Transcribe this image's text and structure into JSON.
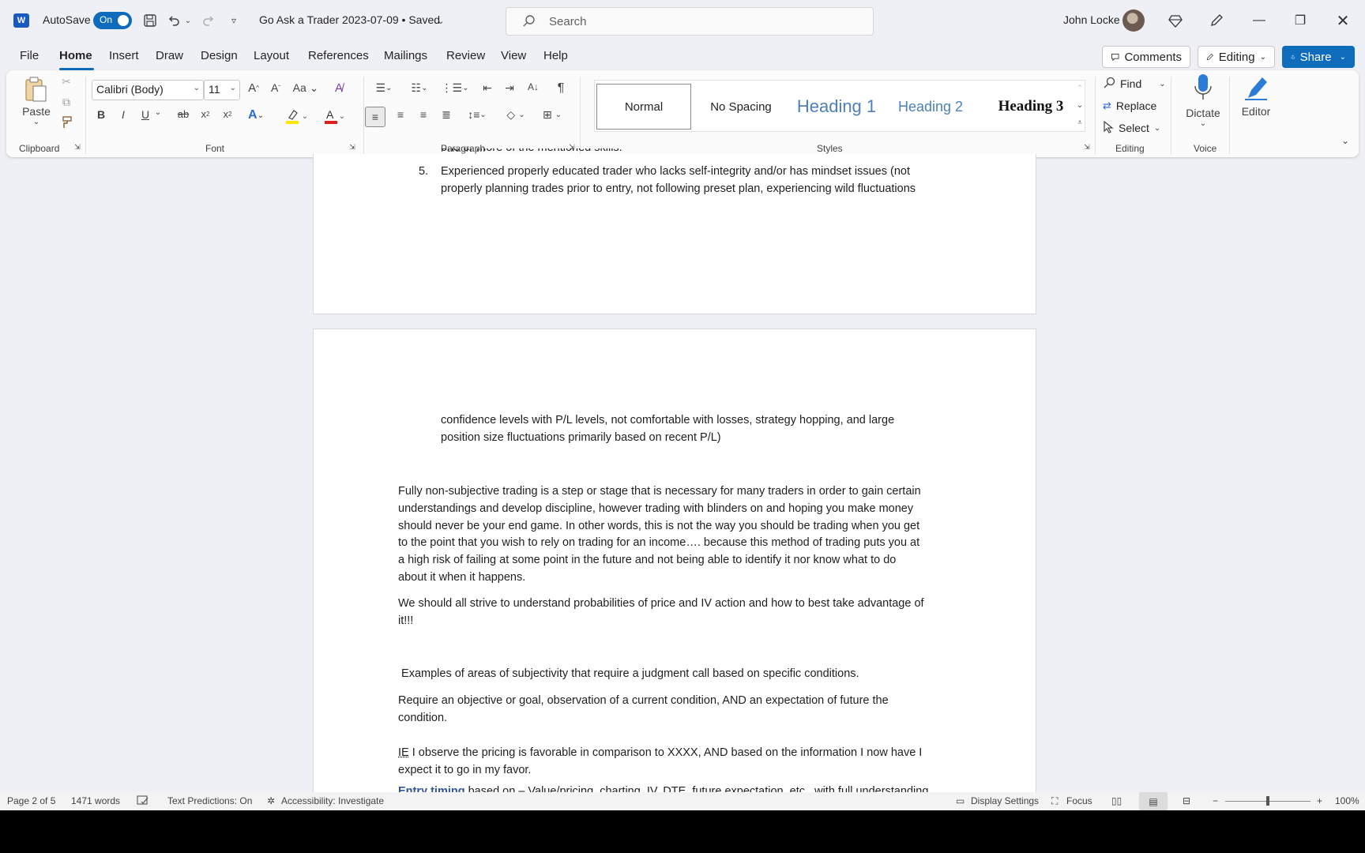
{
  "titlebar": {
    "autosave_label": "AutoSave",
    "autosave_state": "On",
    "doc_title": "Go Ask a Trader 2023-07-09 • Saved",
    "search_placeholder": "Search",
    "user_name": "John Locke"
  },
  "tabs": [
    "File",
    "Home",
    "Insert",
    "Draw",
    "Design",
    "Layout",
    "References",
    "Mailings",
    "Review",
    "View",
    "Help"
  ],
  "top_buttons": {
    "comments": "Comments",
    "editing": "Editing",
    "share": "Share"
  },
  "ribbon": {
    "clipboard": {
      "paste": "Paste",
      "label": "Clipboard"
    },
    "font": {
      "name": "Calibri (Body)",
      "size": "11",
      "label": "Font"
    },
    "paragraph": {
      "label": "Paragraph"
    },
    "styles": {
      "label": "Styles",
      "items": [
        "Normal",
        "No Spacing",
        "Heading 1",
        "Heading 2",
        "Heading 3"
      ]
    },
    "editing": {
      "find": "Find",
      "replace": "Replace",
      "select": "Select",
      "label": "Editing"
    },
    "voice": {
      "dictate": "Dictate",
      "label": "Voice"
    },
    "editor": {
      "label": "Editor"
    }
  },
  "document": {
    "cut_line": "one or more of the mentioned skills.",
    "list_num": "5.",
    "list_item_line1": "Experienced properly educated trader who lacks self-integrity and/or has mindset issues (not",
    "list_item_line2": "properly planning trades prior to entry, not following preset plan, experiencing wild fluctuations",
    "cont_line1": "confidence levels with P/L levels, not comfortable with losses, strategy hopping, and large",
    "cont_line2": "position size fluctuations primarily based on recent P/L)",
    "para1": [
      "Fully non-subjective trading is a step or stage that is necessary for many traders in order to gain certain",
      "understandings and develop discipline, however trading with blinders on and hoping you make money",
      "should never be your end game.  In other words, this is not the way you should be trading when you get",
      "to the point that you wish to rely on trading for an income…. because this method of trading puts you at",
      "a high risk of failing at some point in the future and not being able to identify it nor know what to do",
      "about it when it happens."
    ],
    "para2": [
      "We should all strive to understand probabilities of price and IV action and how to best take advantage of",
      "it!!!"
    ],
    "para3": " Examples of areas of subjectivity that require a judgment call based on specific conditions.",
    "para4": [
      "Require an objective or goal, observation of a current condition, AND an expectation of future the",
      "condition."
    ],
    "para5_ie": "IE",
    "para5_rest": " I observe the pricing is favorable in comparison to XXXX, AND based on the information I now have I",
    "para5_line2": "expect it to go in my favor.",
    "para6_bold": "Entry timing",
    "para6_rest": " based on – Value/pricing, charting, IV, DTE, future expectation, etc., with full understanding"
  },
  "statusbar": {
    "page": "Page 2 of 5",
    "words": "1471 words",
    "text_predictions": "Text Predictions: On",
    "accessibility": "Accessibility: Investigate",
    "display_settings": "Display Settings",
    "focus": "Focus",
    "zoom": "100%"
  }
}
